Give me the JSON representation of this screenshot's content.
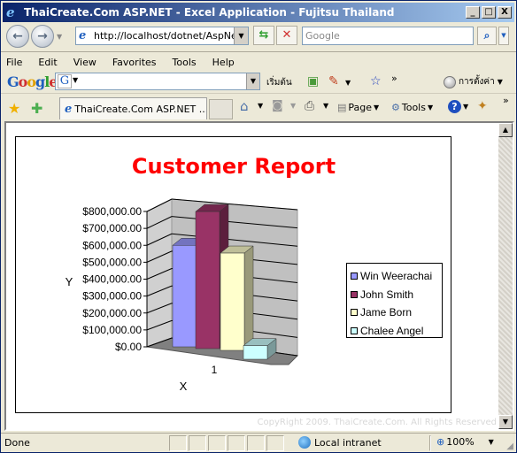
{
  "window": {
    "title": "ThaiCreate.Com ASP.NET - Excel Application - Fujitsu Thailand",
    "controls": {
      "minimize": "_",
      "maximize": "□",
      "close": "X"
    }
  },
  "address": {
    "url": "http://localhost/dotnet/AspNetE",
    "search_placeholder": "Google"
  },
  "menu": [
    "File",
    "Edit",
    "View",
    "Favorites",
    "Tools",
    "Help"
  ],
  "google_toolbar": {
    "logo": "Google",
    "home_label": "เริ่มต้น",
    "settings_label": "การตั้งค่า"
  },
  "tab": {
    "label": "ThaiCreate.Com ASP.NET ...",
    "page_label": "Page",
    "tools_label": "Tools"
  },
  "content": {
    "copyright": "CopyRight 2009. ThaiCreate.Com. All Rights Reserved"
  },
  "status": {
    "text": "Done",
    "zone": "Local intranet",
    "zoom": "100%"
  },
  "chart_data": {
    "type": "bar",
    "style": "3d-column",
    "title": "Customer Report",
    "title_color": "#ff0000",
    "xlabel": "X",
    "ylabel": "Y",
    "categories": [
      "1"
    ],
    "ylim": [
      0,
      800000
    ],
    "yticks": [
      "$0.00",
      "$100,000.00",
      "$200,000.00",
      "$300,000.00",
      "$400,000.00",
      "$500,000.00",
      "$600,000.00",
      "$700,000.00",
      "$800,000.00"
    ],
    "legend_position": "right",
    "grid": true,
    "series": [
      {
        "name": "Win Weerachai",
        "values": [
          600000
        ],
        "color": "#9999ff"
      },
      {
        "name": "John Smith",
        "values": [
          810000
        ],
        "color": "#993366"
      },
      {
        "name": "Jame Born",
        "values": [
          575000
        ],
        "color": "#ffffcc"
      },
      {
        "name": "Chalee Angel",
        "values": [
          80000
        ],
        "color": "#ccffff"
      }
    ]
  }
}
